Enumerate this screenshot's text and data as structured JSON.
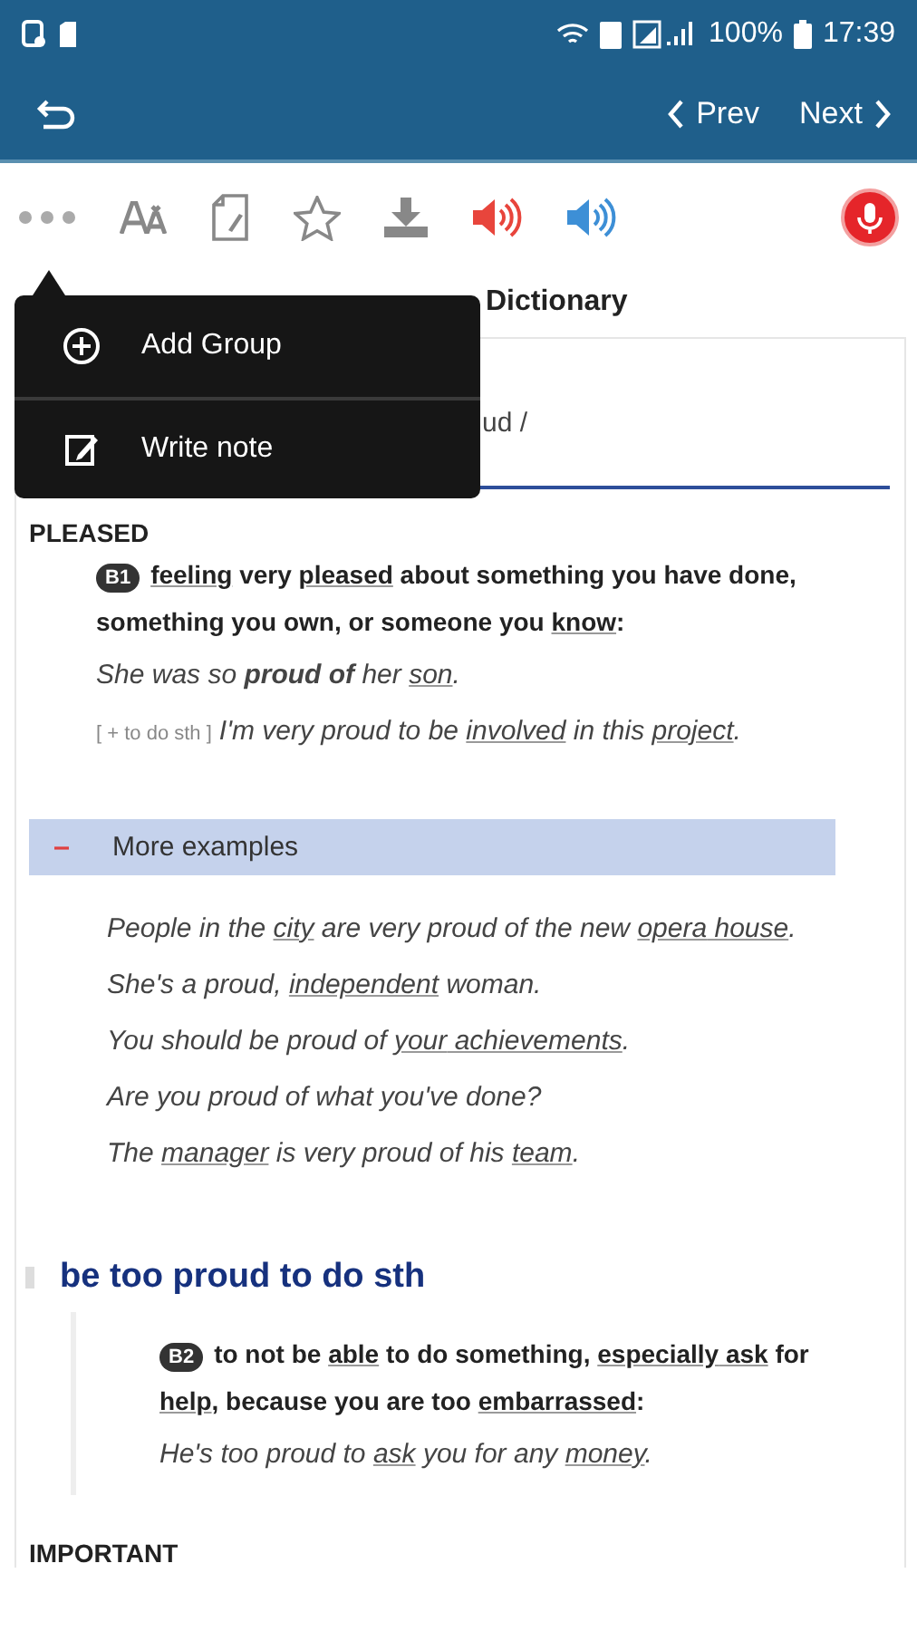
{
  "status_bar": {
    "battery": "100%",
    "time": "17:39"
  },
  "app_bar": {
    "prev": "Prev",
    "next": "Next"
  },
  "page_title": "Dictionary",
  "entry": {
    "pronunciation": "ud /"
  },
  "popup_menu": {
    "items": [
      {
        "label": "Add Group",
        "kind": "add"
      },
      {
        "label": "Write note",
        "kind": "note"
      }
    ]
  },
  "sense": {
    "heading": "PLEASED",
    "level": "B1",
    "definition": [
      {
        "text": "feeling",
        "link": true
      },
      {
        "text": " very ",
        "link": false
      },
      {
        "text": "pleased",
        "link": true
      },
      {
        "text": " about something you have done, something you own, or someone you ",
        "link": false
      },
      {
        "text": "know",
        "link": true
      },
      {
        "text": ":",
        "link": false
      }
    ],
    "examples": [
      {
        "parts": [
          {
            "text": "She was so **proud of** her ",
            "link": false
          },
          {
            "text": "son",
            "link": true
          },
          {
            "text": ".",
            "link": false
          }
        ]
      },
      {
        "pattern": "[ + to do sth ]",
        "parts": [
          {
            "text": "I'm very proud to be ",
            "link": false
          },
          {
            "text": "involved",
            "link": true
          },
          {
            "text": " in this ",
            "link": false
          },
          {
            "text": "project",
            "link": true
          },
          {
            "text": ".",
            "link": false
          }
        ]
      }
    ]
  },
  "more_examples": {
    "label": "More examples",
    "expanded": true,
    "items": [
      [
        {
          "text": "People in the ",
          "link": false
        },
        {
          "text": "city",
          "link": true
        },
        {
          "text": " are very proud of the new ",
          "link": false
        },
        {
          "text": "opera",
          "link": true
        },
        {
          "text": " house",
          "link": true
        },
        {
          "text": ".",
          "link": false
        }
      ],
      [
        {
          "text": "She's a proud, ",
          "link": false
        },
        {
          "text": "independent",
          "link": true
        },
        {
          "text": " woman.",
          "link": false
        }
      ],
      [
        {
          "text": "You should be proud of ",
          "link": false
        },
        {
          "text": "your",
          "link": true
        },
        {
          "text": " achievements",
          "link": true
        },
        {
          "text": ".",
          "link": false
        }
      ],
      [
        {
          "text": "Are you proud of what you've done?",
          "link": false
        }
      ],
      [
        {
          "text": "The ",
          "link": false
        },
        {
          "text": "manager",
          "link": true
        },
        {
          "text": " is very proud of his ",
          "link": false
        },
        {
          "text": "team",
          "link": true
        },
        {
          "text": ".",
          "link": false
        }
      ]
    ]
  },
  "idiom": {
    "phrase": "be too proud to do sth",
    "level": "B2",
    "definition": [
      {
        "text": "to not be ",
        "link": false
      },
      {
        "text": "able",
        "link": true
      },
      {
        "text": " to do something, ",
        "link": false
      },
      {
        "text": "especially",
        "link": true
      },
      {
        "text": " ask",
        "link": true
      },
      {
        "text": " for ",
        "link": false
      },
      {
        "text": "help",
        "link": true
      },
      {
        "text": ", because you are too ",
        "link": false
      },
      {
        "text": "embarrassed",
        "link": true
      },
      {
        "text": ":",
        "link": false
      }
    ],
    "example": [
      {
        "text": "He's too proud to ",
        "link": false
      },
      {
        "text": "ask",
        "link": true
      },
      {
        "text": " you for any ",
        "link": false
      },
      {
        "text": "money",
        "link": true
      },
      {
        "text": ".",
        "link": false
      }
    ]
  },
  "next_heading": "IMPORTANT"
}
